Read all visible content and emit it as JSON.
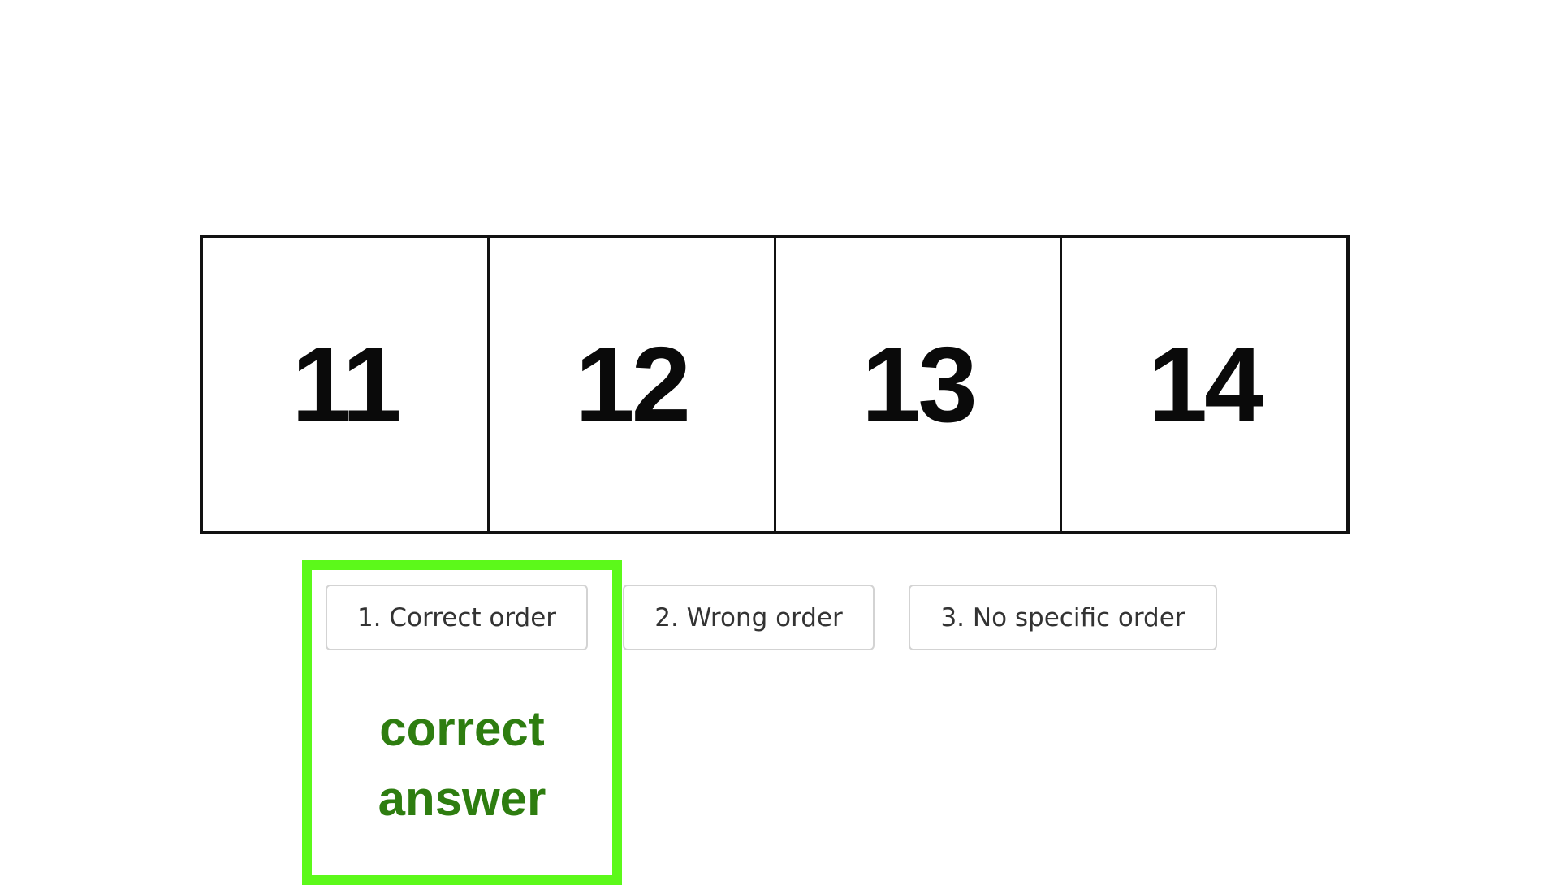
{
  "sequence": [
    "11",
    "12",
    "13",
    "14"
  ],
  "options": [
    {
      "label": "1. Correct order"
    },
    {
      "label": "2. Wrong order"
    },
    {
      "label": "3. No specific order"
    }
  ],
  "annotation": {
    "line1": "correct",
    "line2": "answer",
    "highlight_color": "#5cf91a",
    "text_color": "#2e7d10"
  }
}
